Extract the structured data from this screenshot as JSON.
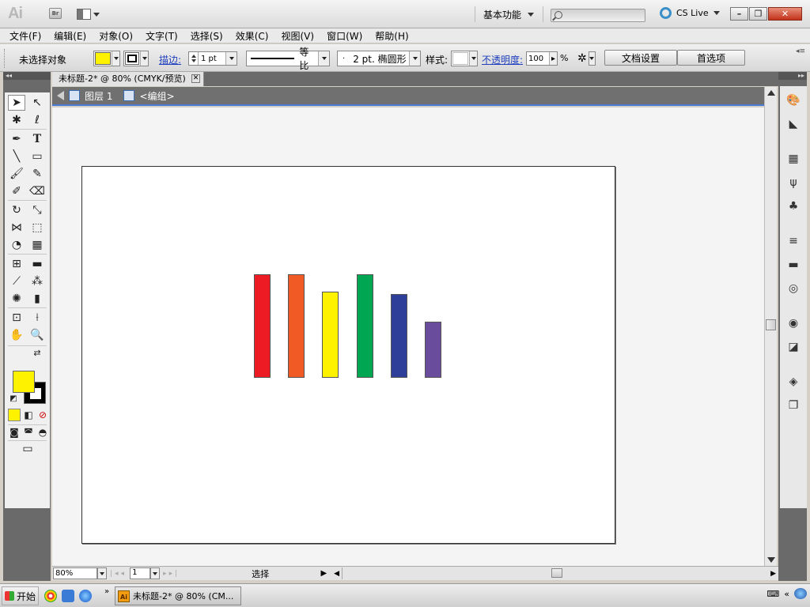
{
  "appbar": {
    "logo": "Ai",
    "bridge_label": "Br",
    "workspace": "基本功能",
    "cslive": "CS Live",
    "window_buttons": [
      "–",
      "❐",
      "✕"
    ]
  },
  "menu": [
    "文件(F)",
    "编辑(E)",
    "对象(O)",
    "文字(T)",
    "选择(S)",
    "效果(C)",
    "视图(V)",
    "窗口(W)",
    "帮助(H)"
  ],
  "control": {
    "selection_status": "未选择对象",
    "fill_color": "#fff200",
    "stroke_color": "#000000",
    "stroke_label": "描边:",
    "stroke_weight": "1 pt",
    "stroke_profile": "等比",
    "brush": "2 pt. 椭圆形",
    "style_label": "样式:",
    "opacity_label": "不透明度:",
    "opacity_value": "100",
    "opacity_unit": "%",
    "doc_setup_button": "文档设置",
    "preferences_button": "首选项"
  },
  "document": {
    "tab_title": "未标题-2* @ 80% (CMYK/预览)",
    "breadcrumb_layer": "图层 1",
    "breadcrumb_group": "<编组>",
    "bars": [
      {
        "color": "#ed1c24",
        "level": 1.0
      },
      {
        "color": "#f15a24",
        "level": 1.0
      },
      {
        "color": "#fff200",
        "level": 0.83
      },
      {
        "color": "#00a651",
        "level": 1.0
      },
      {
        "color": "#2e3f99",
        "level": 0.81
      },
      {
        "color": "#6a4c9c",
        "level": 0.54
      }
    ]
  },
  "status": {
    "zoom": "80%",
    "page": "1",
    "status_text": "选择"
  },
  "taskbar": {
    "start": "开始",
    "task_label": "未标题-2* @ 80% (CM...",
    "task_icon": "Ai"
  }
}
